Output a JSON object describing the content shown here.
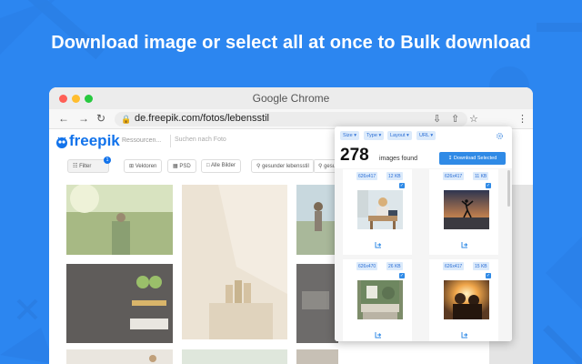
{
  "headline": "Download image or select all at once to Bulk download",
  "colors": {
    "background": "#2c86f0",
    "accent": "#2f8ae6",
    "freepik_blue": "#1273eb"
  },
  "browser": {
    "title": "Google Chrome",
    "url": "de.freepik.com/fotos/lebensstil",
    "icons": [
      "back-arrow-icon",
      "forward-arrow-icon",
      "reload-icon",
      "lock-icon",
      "install-icon",
      "share-icon",
      "bookmark-star-icon",
      "extension-icon",
      "menu-icon"
    ]
  },
  "site": {
    "logo_text": "freepik",
    "resources_label": "Ressourcen...",
    "search_placeholder": "Suchen nach Foto",
    "chips": {
      "filter": "Filter",
      "filter_badge": "1",
      "vectors": "Vektoren",
      "psd": "PSD",
      "all_images": "Alle Bilder",
      "healthy1": "gesunder lebensstil",
      "healthy2": "gesund"
    }
  },
  "popup": {
    "filters": {
      "size": "Size",
      "type": "Type",
      "layout": "Layout",
      "url": "URL"
    },
    "count": "278",
    "count_label": "images found",
    "download_selected": "Download Selected",
    "cards": [
      {
        "dims": "626x417",
        "size": "12 KB"
      },
      {
        "dims": "626x417",
        "size": "11 KB"
      },
      {
        "dims": "626x470",
        "size": "26 KB"
      },
      {
        "dims": "626x417",
        "size": "15 KB"
      }
    ]
  }
}
